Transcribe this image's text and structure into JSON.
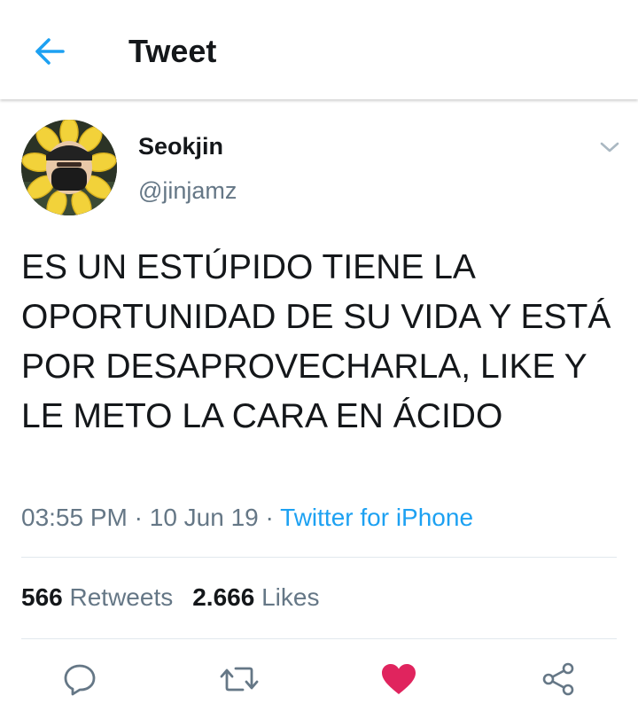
{
  "header": {
    "title": "Tweet",
    "back_icon": "arrow-left-icon"
  },
  "user": {
    "name": "Seokjin",
    "handle": "@jinjamz"
  },
  "tweet": {
    "text": "ES UN ESTÚPIDO TIENE LA OPORTUNIDAD DE SU VIDA Y ESTÁ POR DESAPROVECHARLA, LIKE Y LE METO LA CARA EN ÁCIDO",
    "time": "03:55 PM",
    "separator": " · ",
    "date": "10 Jun 19",
    "source": "Twitter for iPhone"
  },
  "stats": {
    "retweets_count": "566",
    "retweets_label": "Retweets",
    "likes_count": "2.666",
    "likes_label": "Likes"
  },
  "actions": {
    "reply_icon": "reply-icon",
    "retweet_icon": "retweet-icon",
    "like_icon": "heart-icon",
    "share_icon": "share-icon",
    "liked": true
  },
  "colors": {
    "accent": "#1da1f2",
    "like": "#e0245e",
    "muted": "#657786",
    "text": "#14171a",
    "divider": "#e1e8ed"
  }
}
